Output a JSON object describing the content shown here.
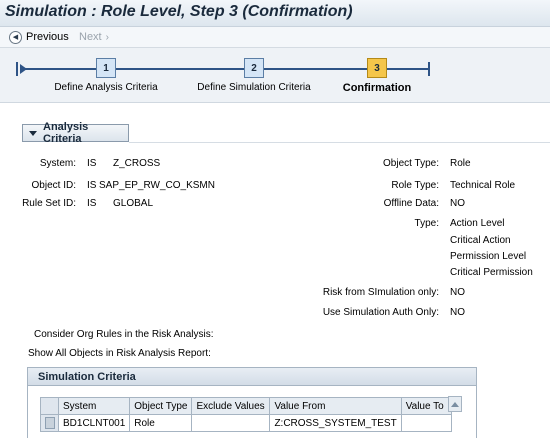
{
  "window": {
    "title": "Simulation : Role Level, Step 3 (Confirmation)"
  },
  "nav": {
    "previous_label": "Previous",
    "next_label": "Next"
  },
  "roadmap": {
    "steps": [
      {
        "number": "1",
        "label": "Define Analysis Criteria"
      },
      {
        "number": "2",
        "label": "Define Simulation Criteria"
      },
      {
        "number": "3",
        "label": "Confirmation"
      }
    ]
  },
  "analysis_criteria": {
    "header": "Analysis Criteria",
    "system_label": "System:",
    "system_op": "IS",
    "system_value": "Z_CROSS",
    "object_id_label": "Object ID:",
    "object_id_op": "IS",
    "object_id_value": "SAP_EP_RW_CO_KSMN",
    "rule_set_label": "Rule Set ID:",
    "rule_set_op": "IS",
    "rule_set_value": "GLOBAL",
    "object_type_label": "Object Type:",
    "object_type_value": "Role",
    "role_type_label": "Role Type:",
    "role_type_value": "Technical Role",
    "offline_data_label": "Offline Data:",
    "offline_data_value": "NO",
    "type_label": "Type:",
    "type_values": [
      "Action Level",
      "Critical Action",
      "Permission Level",
      "Critical Permission"
    ],
    "risk_sim_label": "Risk from SImulation only:",
    "risk_sim_value": "NO",
    "use_sim_auth_label": "Use Simulation Auth Only:",
    "use_sim_auth_value": "NO",
    "org_rules_label": "Consider Org Rules in the Risk Analysis:",
    "show_all_label": "Show All Objects in Risk Analysis Report:"
  },
  "simulation_criteria": {
    "header": "Simulation Criteria",
    "columns": [
      "System",
      "Object Type",
      "Exclude Values",
      "Value From",
      "Value To"
    ],
    "rows": [
      [
        "BD1CLNT001",
        "Role",
        "",
        "Z:CROSS_SYSTEM_TEST",
        ""
      ]
    ]
  },
  "colors": {
    "accent": "#2e5486",
    "current_step": "#f5c64a",
    "step": "#d4e5f6"
  }
}
